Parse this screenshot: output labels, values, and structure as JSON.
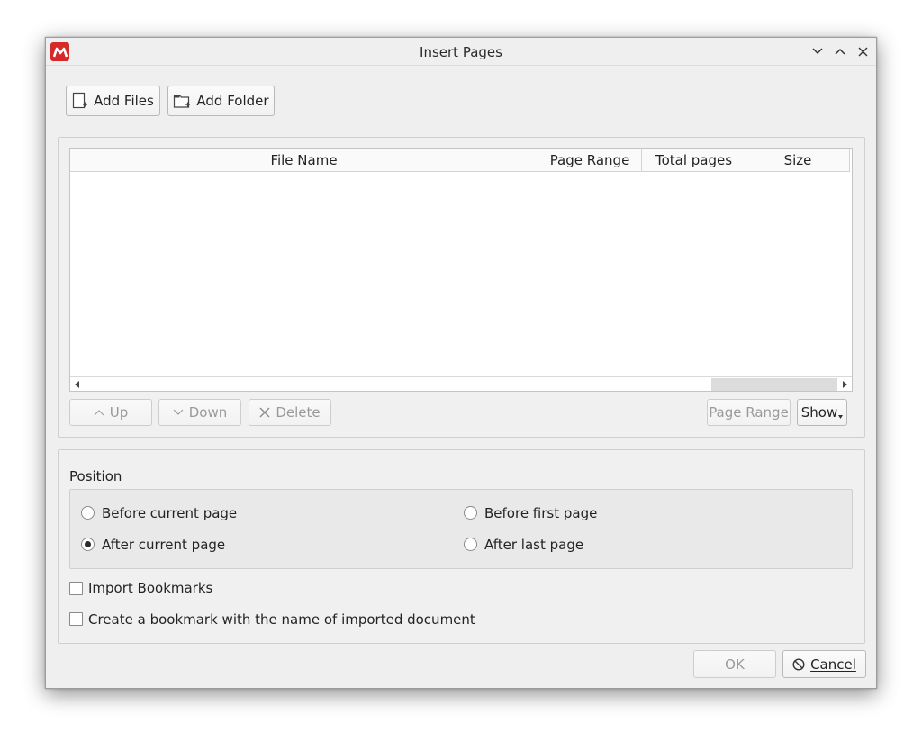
{
  "window": {
    "title": "Insert Pages",
    "app_icon": "master-pdf-icon"
  },
  "toolbar": {
    "add_files_label": "Add Files",
    "add_folder_label": "Add Folder"
  },
  "file_table": {
    "columns": [
      "File Name",
      "Page Range",
      "Total pages",
      "Size"
    ],
    "rows": []
  },
  "list_actions": {
    "up_label": "Up",
    "down_label": "Down",
    "delete_label": "Delete",
    "page_range_label": "Page Range",
    "show_label": "Show"
  },
  "position": {
    "heading": "Position",
    "options": [
      {
        "label": "Before current page",
        "checked": false
      },
      {
        "label": "After current page",
        "checked": true
      },
      {
        "label": "Before first page",
        "checked": false
      },
      {
        "label": "After last page",
        "checked": false
      }
    ]
  },
  "options": {
    "import_bookmarks_label": "Import Bookmarks",
    "create_bookmark_label": "Create a bookmark with the name of imported document"
  },
  "footer": {
    "ok_label": "OK",
    "cancel_label": "Cancel"
  },
  "colors": {
    "dialog_bg": "#efefef",
    "app_icon_red": "#d62a2a",
    "disabled_text": "#9a9a9a"
  }
}
